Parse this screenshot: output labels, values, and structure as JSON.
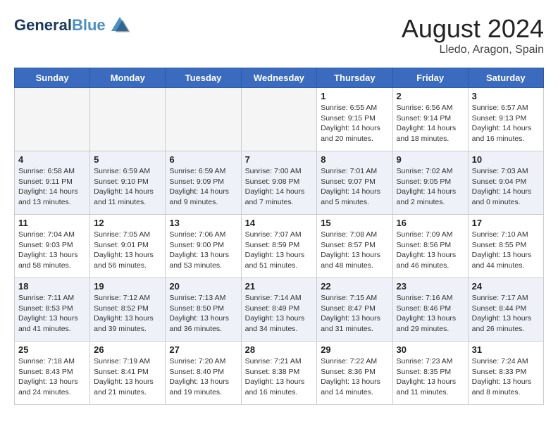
{
  "header": {
    "logo_line1": "General",
    "logo_line2": "Blue",
    "title": "August 2024",
    "subtitle": "Lledo, Aragon, Spain"
  },
  "weekdays": [
    "Sunday",
    "Monday",
    "Tuesday",
    "Wednesday",
    "Thursday",
    "Friday",
    "Saturday"
  ],
  "weeks": [
    [
      {
        "day": "",
        "info": ""
      },
      {
        "day": "",
        "info": ""
      },
      {
        "day": "",
        "info": ""
      },
      {
        "day": "",
        "info": ""
      },
      {
        "day": "1",
        "info": "Sunrise: 6:55 AM\nSunset: 9:15 PM\nDaylight: 14 hours\nand 20 minutes."
      },
      {
        "day": "2",
        "info": "Sunrise: 6:56 AM\nSunset: 9:14 PM\nDaylight: 14 hours\nand 18 minutes."
      },
      {
        "day": "3",
        "info": "Sunrise: 6:57 AM\nSunset: 9:13 PM\nDaylight: 14 hours\nand 16 minutes."
      }
    ],
    [
      {
        "day": "4",
        "info": "Sunrise: 6:58 AM\nSunset: 9:11 PM\nDaylight: 14 hours\nand 13 minutes."
      },
      {
        "day": "5",
        "info": "Sunrise: 6:59 AM\nSunset: 9:10 PM\nDaylight: 14 hours\nand 11 minutes."
      },
      {
        "day": "6",
        "info": "Sunrise: 6:59 AM\nSunset: 9:09 PM\nDaylight: 14 hours\nand 9 minutes."
      },
      {
        "day": "7",
        "info": "Sunrise: 7:00 AM\nSunset: 9:08 PM\nDaylight: 14 hours\nand 7 minutes."
      },
      {
        "day": "8",
        "info": "Sunrise: 7:01 AM\nSunset: 9:07 PM\nDaylight: 14 hours\nand 5 minutes."
      },
      {
        "day": "9",
        "info": "Sunrise: 7:02 AM\nSunset: 9:05 PM\nDaylight: 14 hours\nand 2 minutes."
      },
      {
        "day": "10",
        "info": "Sunrise: 7:03 AM\nSunset: 9:04 PM\nDaylight: 14 hours\nand 0 minutes."
      }
    ],
    [
      {
        "day": "11",
        "info": "Sunrise: 7:04 AM\nSunset: 9:03 PM\nDaylight: 13 hours\nand 58 minutes."
      },
      {
        "day": "12",
        "info": "Sunrise: 7:05 AM\nSunset: 9:01 PM\nDaylight: 13 hours\nand 56 minutes."
      },
      {
        "day": "13",
        "info": "Sunrise: 7:06 AM\nSunset: 9:00 PM\nDaylight: 13 hours\nand 53 minutes."
      },
      {
        "day": "14",
        "info": "Sunrise: 7:07 AM\nSunset: 8:59 PM\nDaylight: 13 hours\nand 51 minutes."
      },
      {
        "day": "15",
        "info": "Sunrise: 7:08 AM\nSunset: 8:57 PM\nDaylight: 13 hours\nand 48 minutes."
      },
      {
        "day": "16",
        "info": "Sunrise: 7:09 AM\nSunset: 8:56 PM\nDaylight: 13 hours\nand 46 minutes."
      },
      {
        "day": "17",
        "info": "Sunrise: 7:10 AM\nSunset: 8:55 PM\nDaylight: 13 hours\nand 44 minutes."
      }
    ],
    [
      {
        "day": "18",
        "info": "Sunrise: 7:11 AM\nSunset: 8:53 PM\nDaylight: 13 hours\nand 41 minutes."
      },
      {
        "day": "19",
        "info": "Sunrise: 7:12 AM\nSunset: 8:52 PM\nDaylight: 13 hours\nand 39 minutes."
      },
      {
        "day": "20",
        "info": "Sunrise: 7:13 AM\nSunset: 8:50 PM\nDaylight: 13 hours\nand 36 minutes."
      },
      {
        "day": "21",
        "info": "Sunrise: 7:14 AM\nSunset: 8:49 PM\nDaylight: 13 hours\nand 34 minutes."
      },
      {
        "day": "22",
        "info": "Sunrise: 7:15 AM\nSunset: 8:47 PM\nDaylight: 13 hours\nand 31 minutes."
      },
      {
        "day": "23",
        "info": "Sunrise: 7:16 AM\nSunset: 8:46 PM\nDaylight: 13 hours\nand 29 minutes."
      },
      {
        "day": "24",
        "info": "Sunrise: 7:17 AM\nSunset: 8:44 PM\nDaylight: 13 hours\nand 26 minutes."
      }
    ],
    [
      {
        "day": "25",
        "info": "Sunrise: 7:18 AM\nSunset: 8:43 PM\nDaylight: 13 hours\nand 24 minutes."
      },
      {
        "day": "26",
        "info": "Sunrise: 7:19 AM\nSunset: 8:41 PM\nDaylight: 13 hours\nand 21 minutes."
      },
      {
        "day": "27",
        "info": "Sunrise: 7:20 AM\nSunset: 8:40 PM\nDaylight: 13 hours\nand 19 minutes."
      },
      {
        "day": "28",
        "info": "Sunrise: 7:21 AM\nSunset: 8:38 PM\nDaylight: 13 hours\nand 16 minutes."
      },
      {
        "day": "29",
        "info": "Sunrise: 7:22 AM\nSunset: 8:36 PM\nDaylight: 13 hours\nand 14 minutes."
      },
      {
        "day": "30",
        "info": "Sunrise: 7:23 AM\nSunset: 8:35 PM\nDaylight: 13 hours\nand 11 minutes."
      },
      {
        "day": "31",
        "info": "Sunrise: 7:24 AM\nSunset: 8:33 PM\nDaylight: 13 hours\nand 8 minutes."
      }
    ]
  ]
}
